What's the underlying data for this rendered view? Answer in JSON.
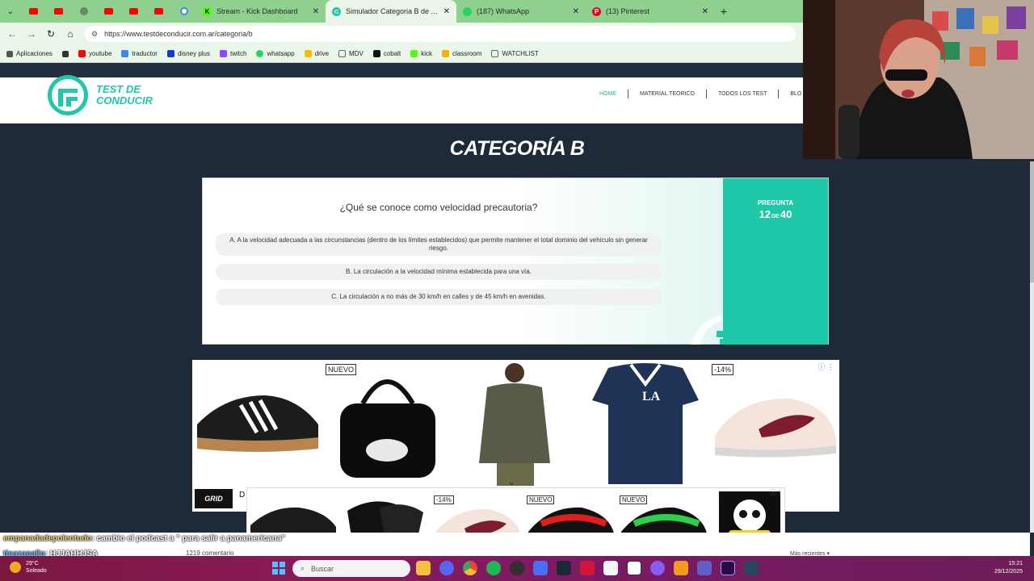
{
  "browser": {
    "tabs": [
      {
        "title": "Stream - Kick Dashboard",
        "favicon_color": "#53fc18",
        "active": false
      },
      {
        "title": "Simulador Categoria B de Argentina",
        "favicon_color": "#1fc8a8",
        "active": true
      },
      {
        "title": "(187) WhatsApp",
        "favicon_color": "#25d366",
        "active": false
      },
      {
        "title": "(13) Pinterest",
        "favicon_color": "#e60023",
        "active": false
      }
    ],
    "close_glyph": "✕",
    "new_tab_glyph": "+",
    "url": "https://www.testdeconducir.com.ar/categoria/b",
    "bookmarks": [
      {
        "label": "Aplicaciones",
        "icon": "apps-grid-icon",
        "color": "#555"
      },
      {
        "label": "",
        "icon": "grid-icon",
        "color": "#333"
      },
      {
        "label": "youtube",
        "icon": "youtube-icon",
        "color": "#ff0000"
      },
      {
        "label": "traductor",
        "icon": "translate-icon",
        "color": "#4285f4"
      },
      {
        "label": "disney plus",
        "icon": "disney-icon",
        "color": "#113ccf"
      },
      {
        "label": "twitch",
        "icon": "twitch-icon",
        "color": "#9146ff"
      },
      {
        "label": "whatsapp",
        "icon": "whatsapp-icon",
        "color": "#25d366"
      },
      {
        "label": "drive",
        "icon": "drive-icon",
        "color": "#fbbc04"
      },
      {
        "label": "MDV",
        "icon": "folder-icon",
        "color": "#666"
      },
      {
        "label": "cobalt",
        "icon": "cobalt-icon",
        "color": "#111"
      },
      {
        "label": "kick",
        "icon": "kick-icon",
        "color": "#53fc18"
      },
      {
        "label": "classroom",
        "icon": "classroom-icon",
        "color": "#f4b400"
      },
      {
        "label": "WATCHLIST",
        "icon": "folder-icon",
        "color": "#666"
      }
    ]
  },
  "site": {
    "logo_line1": "TEST DE",
    "logo_line2": "CONDUCIR",
    "nav": [
      "HOME",
      "MATERIAL TEORICO",
      "TODOS LOS TEST",
      "BLO"
    ],
    "page_title": "CATEGORÍA B"
  },
  "quiz": {
    "question": "¿Qué se conoce como velocidad precautoria?",
    "options": [
      "A. A la velocidad adecuada a las circunstancias (dentro de los límites establecidos) que permite mantener el total dominio del vehículo sin generar riesgo.",
      "B. La circulación a la velocidad mínima establecida para una vía.",
      "C. La circulación a no más de 30 km/h en calles y de 45 km/h en avenidas."
    ],
    "counter_label": "PREGUNTA",
    "current": "12",
    "of_label": "DE",
    "total": "40"
  },
  "ads": {
    "badges": [
      "NUEVO",
      "-14%"
    ],
    "strip_badges": [
      "-14%",
      "NUEVO",
      "NUEVO"
    ],
    "brand": "GRID",
    "info_glyph": "ⓘ",
    "close_glyph": "⋮",
    "partial_text": "D",
    "collapse_glyph": "⌄"
  },
  "page_footer": {
    "comments": "1219 comentario",
    "sort": "Más recientes ▾"
  },
  "chat": [
    {
      "user": "empanadadepolentudo",
      "message": ": cambio el podcast a \" para salir a panamericana\""
    },
    {
      "user": "tinazapallo",
      "message": ": HJJAHHJSA"
    }
  ],
  "taskbar": {
    "temperature": "29°C",
    "weather": "Soleado",
    "search_placeholder": "Buscar",
    "time": "15:21",
    "date": "29/12/2025",
    "apps": [
      {
        "name": "file-explorer-icon",
        "color": "#f3c13a"
      },
      {
        "name": "discord-icon",
        "color": "#5865f2"
      },
      {
        "name": "chrome-icon",
        "color": "#e8453c"
      },
      {
        "name": "spotify-icon",
        "color": "#1db954"
      },
      {
        "name": "obs-icon",
        "color": "#302e31"
      },
      {
        "name": "media-player-icon",
        "color": "#4b6ef5"
      },
      {
        "name": "steam-icon",
        "color": "#1b2838"
      },
      {
        "name": "app-red-icon",
        "color": "#d4143a"
      },
      {
        "name": "app-white-icon",
        "color": "#f5f5f5"
      },
      {
        "name": "notion-icon",
        "color": "#ffffff"
      },
      {
        "name": "messenger-icon",
        "color": "#8a5cf6"
      },
      {
        "name": "fl-studio-icon",
        "color": "#f29b1d"
      },
      {
        "name": "teams-icon",
        "color": "#5b5fc7"
      },
      {
        "name": "premiere-icon",
        "color": "#2a0a4a"
      },
      {
        "name": "steam-alt-icon",
        "color": "#2a475e"
      }
    ]
  },
  "colors": {
    "accent": "#1fc8a8",
    "tabstrip": "#8fd08f",
    "page_bg": "#1f2a38"
  }
}
